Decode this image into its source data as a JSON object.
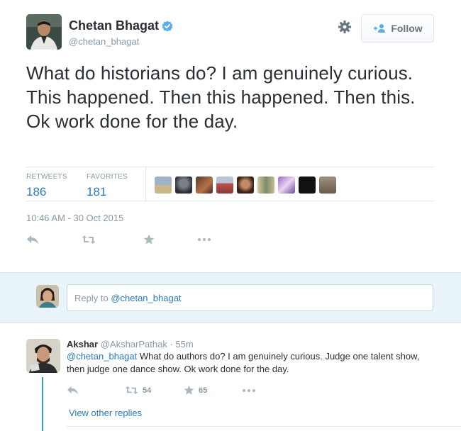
{
  "tweet": {
    "author_name": "Chetan Bhagat",
    "author_handle": "@chetan_bhagat",
    "follow_label": "Follow",
    "text": "What do historians do? I am genuinely curious. This happened. Then this happened. Then this. Ok work done for the day.",
    "stats": {
      "retweets_label": "RETWEETS",
      "retweets_count": "186",
      "favorites_label": "FAVORITES",
      "favorites_count": "181"
    },
    "timestamp": "10:46 AM - 30 Oct 2015",
    "favoriter_faces": 9
  },
  "reply_box": {
    "placeholder_prefix": "Reply to ",
    "mention": "@chetan_bhagat"
  },
  "reply": {
    "author_name": "Akshar",
    "author_handle": "@AksharPathak",
    "time": "· 55m",
    "mention": "@chetan_bhagat",
    "text": " What do authors do? I am genuinely curious. Judge one talent show, then judge one dance show. Ok work done for the day.",
    "retweet_count": "54",
    "favorite_count": "65",
    "view_other_replies": "View other replies"
  },
  "colors": {
    "link": "#2b7bb9",
    "muted": "#8899a6",
    "reply_bg": "#e8f4f9",
    "thread_line": "#2b9fd1",
    "verified": "#55acee"
  },
  "icons": [
    "verified-icon",
    "gear-icon",
    "follow-person-icon",
    "reply-icon",
    "retweet-icon",
    "favorite-icon",
    "more-icon"
  ]
}
